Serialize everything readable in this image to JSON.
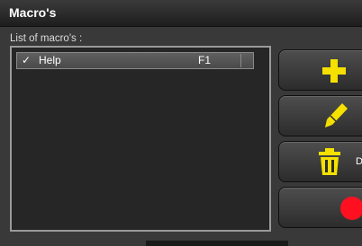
{
  "window": {
    "title": "Macro's"
  },
  "list": {
    "label": "List of macro's :",
    "items": [
      {
        "checked": true,
        "check_mark": "✓",
        "name": "Help",
        "key": "F1"
      }
    ]
  },
  "buttons": {
    "add": {
      "icon": "plus-icon",
      "color": "#f5e000"
    },
    "edit": {
      "icon": "pencil-icon",
      "color": "#f5e000"
    },
    "delete": {
      "icon": "trash-icon",
      "color": "#f5e000",
      "label": "D"
    },
    "record": {
      "icon": "record-icon",
      "color": "#ff1020"
    }
  }
}
